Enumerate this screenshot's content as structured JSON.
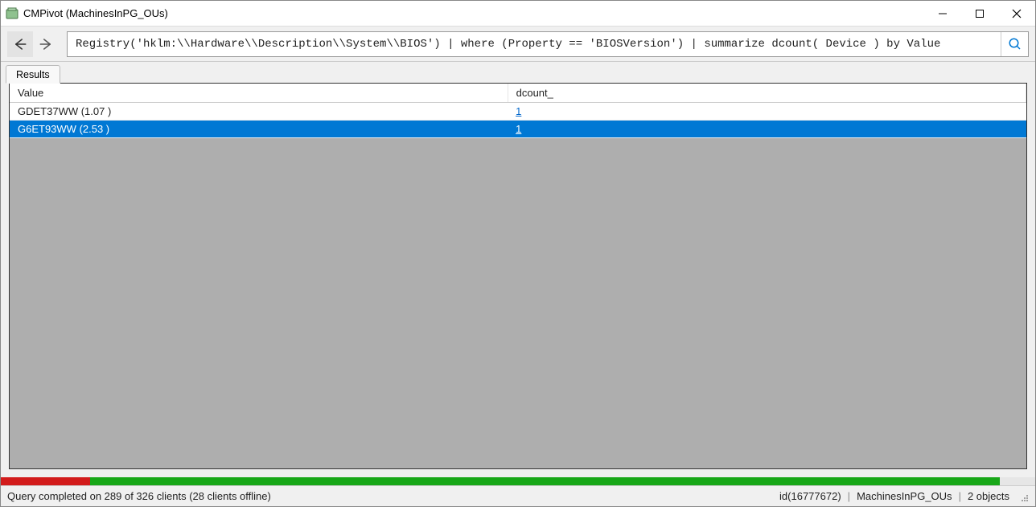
{
  "window": {
    "title": "CMPivot (MachinesInPG_OUs)"
  },
  "toolbar": {
    "query": "Registry('hklm:\\\\Hardware\\\\Description\\\\System\\\\BIOS') | where (Property == 'BIOSVersion') | summarize dcount( Device ) by Value"
  },
  "tabs": {
    "results_label": "Results"
  },
  "grid": {
    "columns": {
      "value": "Value",
      "dcount": "dcount_"
    },
    "rows": [
      {
        "value": "GDET37WW (1.07 )",
        "dcount": "1",
        "selected": false
      },
      {
        "value": "G6ET93WW (2.53 )",
        "dcount": "1",
        "selected": true
      }
    ]
  },
  "progress": {
    "red_pct": 8.6,
    "green_pct": 88.0
  },
  "status": {
    "left": "Query completed on 289 of 326 clients (28 clients offline)",
    "id": "id(16777672)",
    "collection": "MachinesInPG_OUs",
    "objects": "2 objects"
  }
}
